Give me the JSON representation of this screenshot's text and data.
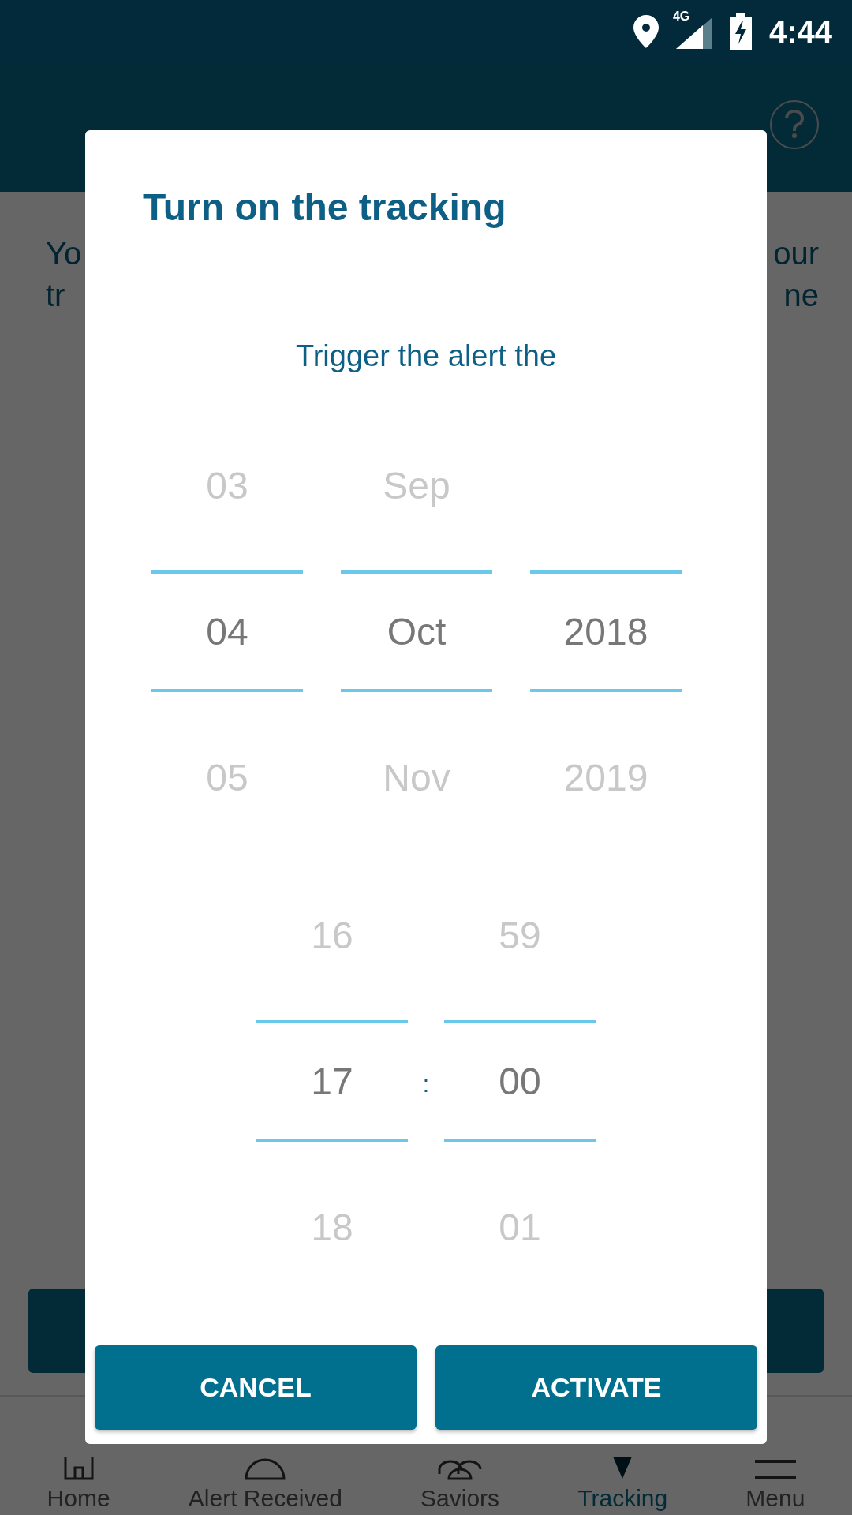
{
  "status_bar": {
    "network": "4G",
    "time": "4:44"
  },
  "background_text": {
    "left": [
      "Yo",
      "tr"
    ],
    "right": [
      "our",
      "ne"
    ]
  },
  "bottom_nav": [
    {
      "kind": "home",
      "label": "Home",
      "selected": false
    },
    {
      "kind": "alert",
      "label": "Alert Received",
      "selected": false
    },
    {
      "kind": "saviors",
      "label": "Saviors",
      "selected": false
    },
    {
      "kind": "tracking",
      "label": "Tracking",
      "selected": true
    },
    {
      "kind": "menu",
      "label": "Menu",
      "selected": false
    }
  ],
  "dialog": {
    "title": "Turn on the tracking",
    "subtitle": "Trigger the alert the",
    "date_picker": [
      {
        "prev": "03",
        "value": "04",
        "next": "05"
      },
      {
        "prev": "Sep",
        "value": "Oct",
        "next": "Nov"
      },
      {
        "value": "2018",
        "next": "2019"
      }
    ],
    "time_picker": {
      "separator": ":",
      "columns": [
        {
          "prev": "16",
          "value": "17",
          "next": "18"
        },
        {
          "prev": "59",
          "value": "00",
          "next": "01"
        }
      ]
    },
    "buttons": [
      "CANCEL",
      "ACTIVATE"
    ]
  }
}
